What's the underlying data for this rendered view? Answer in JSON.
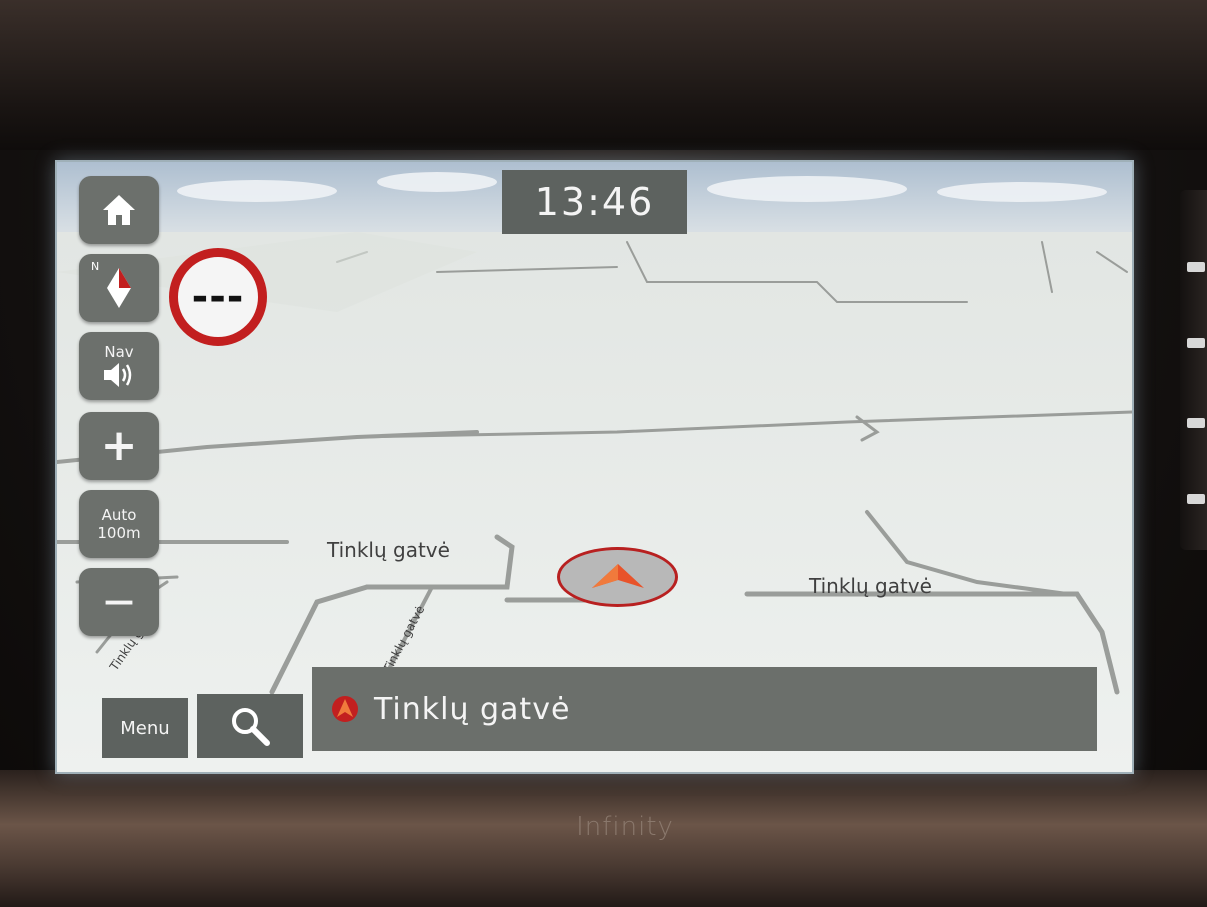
{
  "status": {
    "clock": "13:46"
  },
  "map_controls": {
    "home_icon": "home-icon",
    "compass_north_label": "N",
    "nav_volume_label": "Nav",
    "zoom_in_label": "+",
    "scale_mode_label": "Auto",
    "scale_value": "100m",
    "zoom_out_label": "—"
  },
  "speed_limit": {
    "value": "---",
    "color": "#c21f1f"
  },
  "map": {
    "street_labels": [
      "Tinklų gatvė",
      "Tinklų gatvė"
    ],
    "rotated_street_labels": [
      "Tinklų gatvė",
      "Tinklų gatvė"
    ]
  },
  "bottom_bar": {
    "menu_label": "Menu",
    "search_icon": "search-icon",
    "current_street": "Tinklų gatvė"
  },
  "device": {
    "brand": "Infinity"
  },
  "colors": {
    "accent": "#c21f1f",
    "button": "#6c706c",
    "bar": "#5d625f"
  }
}
